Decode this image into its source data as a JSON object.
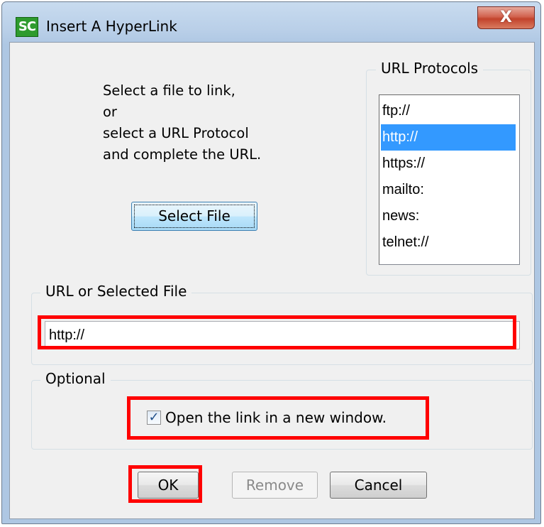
{
  "window": {
    "icon_text": "SC",
    "title": "Insert A HyperLink",
    "close_glyph": "X"
  },
  "instructions": [
    "Select a file to link,",
    "or",
    "select a URL Protocol",
    "and complete the URL."
  ],
  "select_file_label": "Select File",
  "protocols": {
    "legend": "URL Protocols",
    "items": [
      "ftp://",
      "http://",
      "https://",
      "mailto:",
      "news:",
      "telnet://"
    ],
    "selected": "http://"
  },
  "url": {
    "legend": "URL or Selected File",
    "value": "http://"
  },
  "optional": {
    "legend": "Optional",
    "new_window_label": "Open the link in a new window.",
    "new_window_checked": true
  },
  "buttons": {
    "ok": "OK",
    "remove": "Remove",
    "cancel": "Cancel"
  },
  "colors": {
    "selection": "#3399ff",
    "highlight": "#ff0000"
  }
}
